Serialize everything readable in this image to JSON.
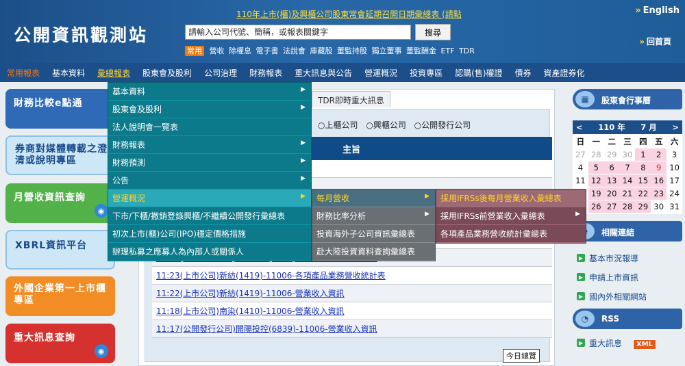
{
  "header": {
    "logo": "公開資訊觀測站",
    "notice": "110年上市(櫃)及興櫃公司股東常會延期召開日期彙總表 (請點",
    "english": "English",
    "home": "回首頁",
    "search_placeholder": "請輸入公司代號、簡稱，或報表關鍵字",
    "search_button": "搜尋",
    "quick_badge": "常用",
    "quick_links": [
      "營收",
      "除權息",
      "電子書",
      "法說會",
      "庫藏股",
      "董監持股",
      "獨立董事",
      "董監酬金",
      "ETF",
      "TDR"
    ]
  },
  "mainnav": [
    "常用報表",
    "基本資料",
    "彙總報表",
    "股東會及股利",
    "公司治理",
    "財務報表",
    "重大訊息與公告",
    "營運概況",
    "投資專區",
    "認購(售)權證",
    "債券",
    "資產證券化"
  ],
  "banners": [
    "財務比較e點通",
    "券商對媒體轉載之澄清或說明專區",
    "月營收資訊查詢",
    "XBRL資訊平台",
    "外國企業第一上市櫃專區",
    "重大訊息查詢"
  ],
  "content": {
    "tab": "TDR即時重大訊息",
    "radios": [
      "上櫃公司",
      "興櫃公司",
      "公開發行公司"
    ],
    "table_header": "主旨",
    "rows": [
      "006-營業收入資訊",
      "",
      "",
      "",
      "",
      "11:23(公開發行公司)麗冠有線(8981)-11006-營業收入資訊",
      "11:23(上市公司)新紡(1419)-11006-各項產品業務營收統計表",
      "11:22(上市公司)新紡(1419)-11006-營業收入資訊",
      "11:18(上市公司)南染(1410)-11006-營業收入資訊",
      "11:17(公開發行公司)開陽投控(6839)-11006-營業收入資訊"
    ],
    "all_day": "今日總覽"
  },
  "menu1": [
    "基本資料",
    "股東會及股利",
    "法人說明會一覽表",
    "財務報表",
    "財務預測",
    "公告",
    "營運概況",
    "下市/下櫃/撤銷登錄興櫃/不繼續公開發行彙總表",
    "初次上市(櫃)公司(IPO)穩定價格措施",
    "辦理私募之應募人為內部人或關係人"
  ],
  "menu2": [
    "每月營收",
    "財務比率分析",
    "投資海外子公司資訊彙總表",
    "赴大陸投資資料查詢彙總表"
  ],
  "menu3": [
    "採用IFRSs後每月營業收入彙總表",
    "採用IFRSs前營業收入彙總表",
    "各項產品業務營收統計彙總表"
  ],
  "right": {
    "meeting_title": "股東會行事曆",
    "cal_prev": "<",
    "cal_year": "110 年",
    "cal_month": "7 月",
    "cal_next": ">",
    "weekdays": [
      "日",
      "一",
      "二",
      "三",
      "四",
      "五",
      "六"
    ],
    "links_title": "相關連結",
    "links": [
      "基本市況報導",
      "申請上市資訊",
      "國內外相關網站"
    ],
    "rss_title": "RSS",
    "rss_item": "重大訊息",
    "xml": "XML"
  },
  "colors": {
    "header": "#1f5a96",
    "nav": "#1c4f8a",
    "menu1": "#0c7a8a",
    "menu2": "#6a6f73",
    "menu3": "#7a4a58",
    "accent": "#ffd52a"
  }
}
